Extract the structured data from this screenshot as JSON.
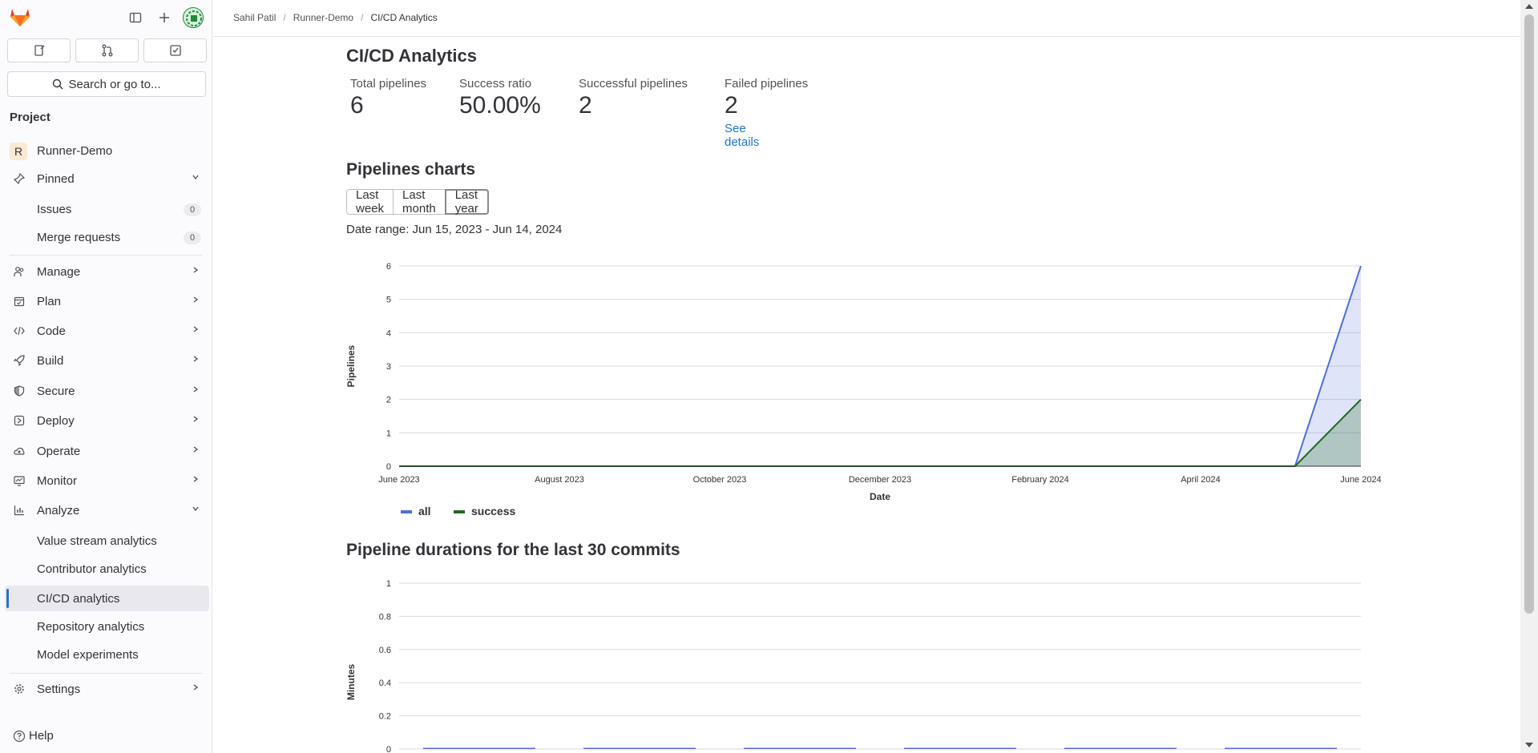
{
  "sidebar": {
    "section_title": "Project",
    "project_name": "Runner-Demo",
    "project_initial": "R",
    "pinned_label": "Pinned",
    "pinned_items": [
      {
        "label": "Issues",
        "count": "0"
      },
      {
        "label": "Merge requests",
        "count": "0"
      }
    ],
    "items": [
      {
        "label": "Manage",
        "icon": "users-icon"
      },
      {
        "label": "Plan",
        "icon": "calendar-icon"
      },
      {
        "label": "Code",
        "icon": "code-icon"
      },
      {
        "label": "Build",
        "icon": "rocket-icon"
      },
      {
        "label": "Secure",
        "icon": "shield-icon"
      },
      {
        "label": "Deploy",
        "icon": "deploy-icon"
      },
      {
        "label": "Operate",
        "icon": "cloud-gear-icon"
      },
      {
        "label": "Monitor",
        "icon": "monitor-icon"
      }
    ],
    "analyze_label": "Analyze",
    "analyze_items": [
      {
        "label": "Value stream analytics"
      },
      {
        "label": "Contributor analytics"
      },
      {
        "label": "CI/CD analytics"
      },
      {
        "label": "Repository analytics"
      },
      {
        "label": "Model experiments"
      }
    ],
    "settings_label": "Settings",
    "search_label": "Search or go to...",
    "help_label": "Help"
  },
  "breadcrumb": [
    "Sahil Patil",
    "Runner-Demo",
    "CI/CD Analytics"
  ],
  "page": {
    "title": "CI/CD Analytics",
    "stats": [
      {
        "label": "Total pipelines",
        "value": "6"
      },
      {
        "label": "Success ratio",
        "value": "50.00%"
      },
      {
        "label": "Successful pipelines",
        "value": "2"
      },
      {
        "label": "Failed pipelines",
        "value": "2"
      }
    ],
    "see_details": "See details",
    "charts_title": "Pipelines charts",
    "ranges": [
      "Last week",
      "Last month",
      "Last year"
    ],
    "selected_range": "Last year",
    "date_range": "Date range: Jun 15, 2023 - Jun 14, 2024",
    "durations_title": "Pipeline durations for the last 30 commits"
  },
  "colors": {
    "all": "#4e6fd8",
    "success": "#1e6b1e",
    "link": "#1f75cb"
  },
  "chart_data": [
    {
      "type": "area",
      "title": "",
      "xlabel": "Date",
      "ylabel": "Pipelines",
      "x_ticks": [
        "June 2023",
        "August 2023",
        "October 2023",
        "December 2023",
        "February 2024",
        "April 2024",
        "June 2024"
      ],
      "ylim": [
        0,
        6
      ],
      "y_ticks": [
        "0",
        "1",
        "2",
        "3",
        "4",
        "5",
        "6"
      ],
      "x": [
        "2023-06-15",
        "2024-05-20",
        "2024-06-14"
      ],
      "series": [
        {
          "name": "all",
          "values": [
            0,
            0,
            6
          ]
        },
        {
          "name": "success",
          "values": [
            0,
            0,
            2
          ]
        }
      ],
      "legend": "bottom-left",
      "grid": true
    },
    {
      "type": "bar",
      "title": "",
      "xlabel": "",
      "ylabel": "Minutes",
      "ylim": [
        0,
        1
      ],
      "y_ticks": [
        "0",
        "0.2",
        "0.4",
        "0.6",
        "0.8",
        "1"
      ],
      "values": [
        0,
        0,
        0,
        0,
        0,
        0
      ],
      "grid": true
    }
  ]
}
